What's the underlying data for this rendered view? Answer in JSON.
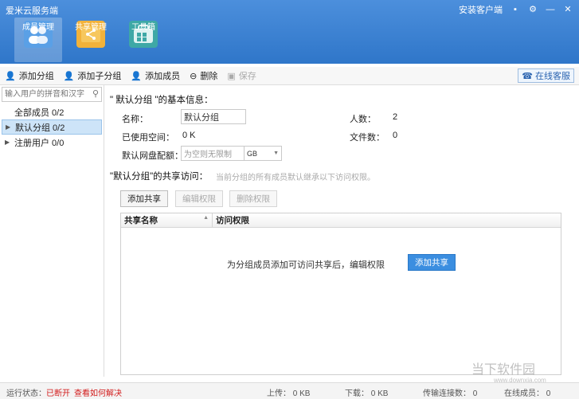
{
  "app": {
    "title": "爱米云服务端",
    "install_client": "安装客户端"
  },
  "nav": [
    {
      "label": "成员管理",
      "icon": "members-icon",
      "active": true
    },
    {
      "label": "共享管理",
      "icon": "share-icon",
      "active": false
    },
    {
      "label": "工具箱",
      "icon": "toolbox-icon",
      "active": false
    }
  ],
  "toolbar": {
    "add_group": "添加分组",
    "add_subgroup": "添加子分组",
    "add_member": "添加成员",
    "delete": "删除",
    "save": "保存",
    "online_service": "在线客服"
  },
  "left": {
    "search_placeholder": "输入用户的拼音和汉字",
    "items": [
      {
        "label": "全部成员 0/2"
      },
      {
        "label": "默认分组 0/2"
      },
      {
        "label": "注册用户 0/0"
      }
    ]
  },
  "main": {
    "basic_title": "\" 默认分组 \"的基本信息：",
    "name_label": "名称：",
    "name_value": "默认分组",
    "used_label": "已使用空间：",
    "used_value": "0 K",
    "quota_label": "默认网盘配额：",
    "quota_placeholder": "为空则无限制",
    "quota_unit": "GB",
    "people_label": "人数：",
    "people_value": "2",
    "files_label": "文件数：",
    "files_value": "0",
    "share_title": "\"默认分组\"的共享访问：",
    "share_hint": "当前分组的所有成员默认继承以下访问权限。",
    "add_share": "添加共享",
    "edit_perm": "编辑权限",
    "delete_perm": "删除权限",
    "col_share_name": "共享名称",
    "col_access": "访问权限",
    "empty_msg": "为分组成员添加可访问共享后，编辑权限",
    "empty_btn": "添加共享"
  },
  "status": {
    "run_label": "运行状态：",
    "run_value": "已断开",
    "how_fix": "查看如何解决",
    "upload": "上传：  0 KB",
    "download": "下载：  0 KB",
    "connections": "传输连接数：  0",
    "online": "在线成员：  0"
  },
  "watermark": {
    "text": "当下软件园",
    "sub": "www.downxia.com"
  }
}
